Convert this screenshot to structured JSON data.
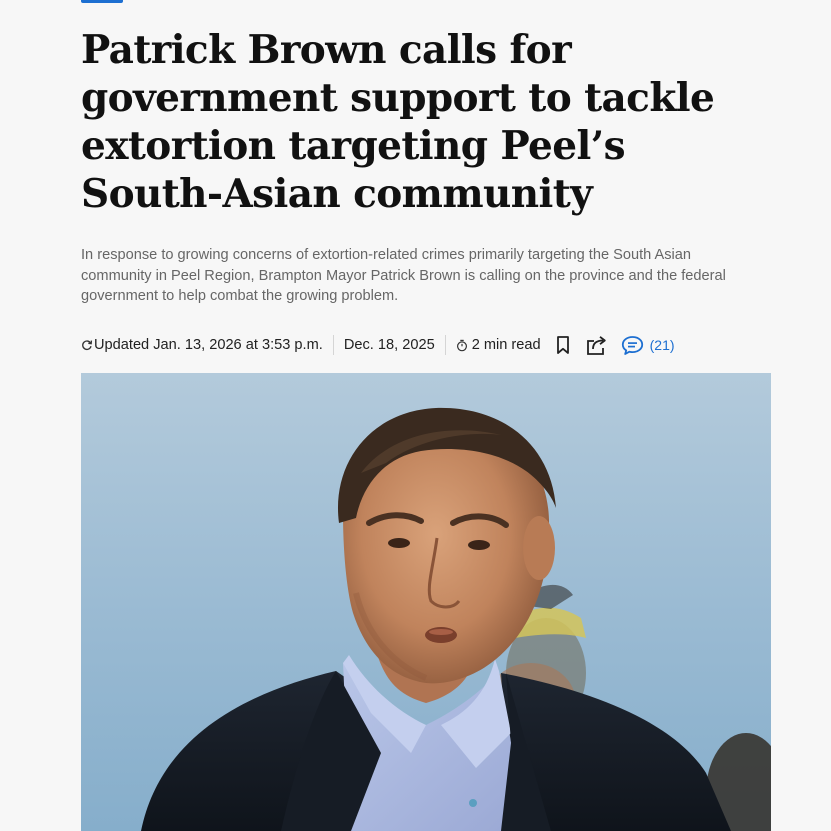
{
  "article": {
    "headline": "Patrick Brown calls for government support to tackle extortion targeting Peel’s South-Asian community",
    "dek": "In response to growing concerns of extortion-related crimes primarily targeting the South Asian community in Peel Region, Brampton Mayor Patrick Brown is calling on the province and the federal government to help combat the growing problem.",
    "meta": {
      "updated": "Updated Jan. 13, 2026 at 3:53 p.m.",
      "published": "Dec. 18, 2025",
      "read_time": "2 min read",
      "comment_count": "(21)"
    }
  },
  "icons": {
    "updated": "refresh-icon",
    "read_time": "clock-icon",
    "bookmark": "bookmark-icon",
    "share": "share-icon",
    "comments": "comment-icon"
  },
  "colors": {
    "accent": "#1d6fd1",
    "background": "#f7f7f7",
    "headline": "#111111",
    "dek": "#666666"
  }
}
